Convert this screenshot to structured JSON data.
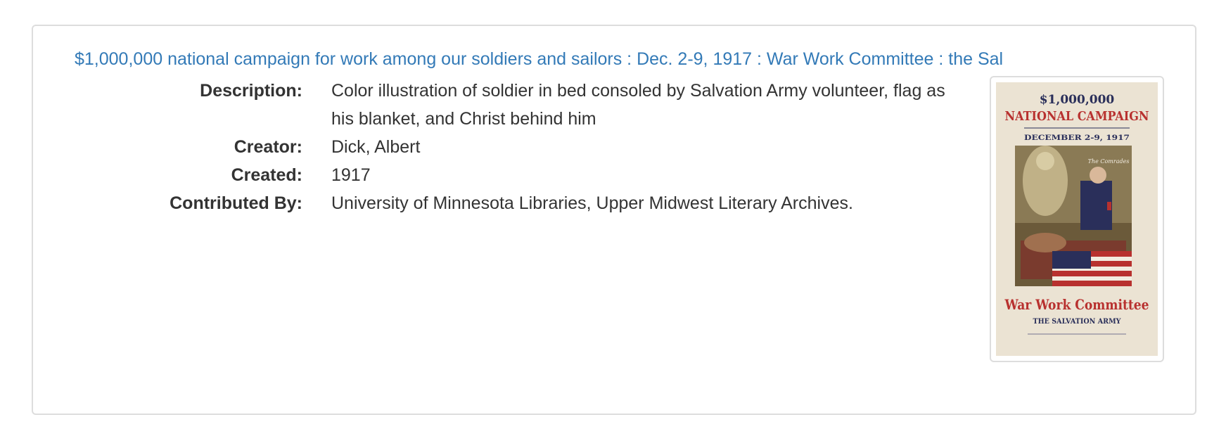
{
  "record": {
    "title": "$1,000,000 national campaign for work among our soldiers and sailors : Dec. 2-9, 1917 : War Work Committee : the Sal",
    "fields": [
      {
        "label": "Description:",
        "value": "Color illustration of soldier in bed consoled by Salvation Army volunteer, flag as his blanket, and Christ behind him"
      },
      {
        "label": "Creator:",
        "value": "Dick, Albert"
      },
      {
        "label": "Created:",
        "value": "1917"
      },
      {
        "label": "Contributed By:",
        "value": "University of Minnesota Libraries, Upper Midwest Literary Archives."
      }
    ],
    "thumbnail": {
      "amount": "$1,000,000",
      "headline": "NATIONAL CAMPAIGN",
      "dates": "DECEMBER 2-9, 1917",
      "comrades": "The Comrades",
      "committee": "War Work Committee",
      "org": "THE SALVATION ARMY"
    }
  },
  "colors": {
    "link": "#337ab7",
    "border": "#dddddd",
    "text": "#333333",
    "poster_red": "#b8312f",
    "poster_navy": "#2a2f5a"
  }
}
